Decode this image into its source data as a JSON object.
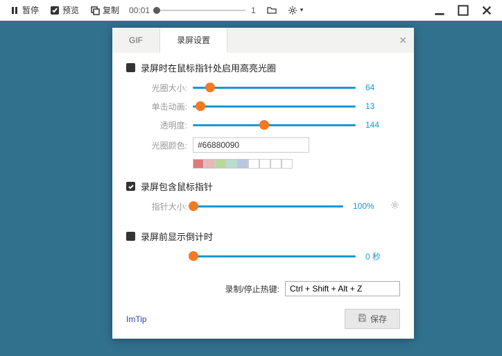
{
  "toolbar": {
    "pause": "暂停",
    "preview": "预览",
    "copy": "复制",
    "time": "00:01",
    "frame": "1"
  },
  "tabs": {
    "gif": "GIF",
    "settings": "录屏设置"
  },
  "section1": {
    "title": "录屏时在鼠标指针处启用高亮光圈",
    "size_label": "光圈大小:",
    "size_value": "64",
    "click_label": "单击动画:",
    "click_value": "13",
    "opacity_label": "透明度:",
    "opacity_value": "144",
    "color_label": "光圈颜色:",
    "color_value": "#66880090"
  },
  "swatches": [
    "#e07a7a",
    "#e8b7b7",
    "#b7d89a",
    "#b7dcd0",
    "#b7c7e0",
    "#ffffff",
    "#ffffff",
    "#ffffff",
    "#ffffff"
  ],
  "section2": {
    "title": "录屏包含鼠标指针",
    "size_label": "指针大小:",
    "size_value": "100%"
  },
  "section3": {
    "title": "录屏前显示倒计时",
    "value": "0 秒"
  },
  "hotkey": {
    "label": "录制/停止热键:",
    "value": "Ctrl + Shift + Alt + Z"
  },
  "footer": {
    "link": "ImTip",
    "save": "保存"
  }
}
